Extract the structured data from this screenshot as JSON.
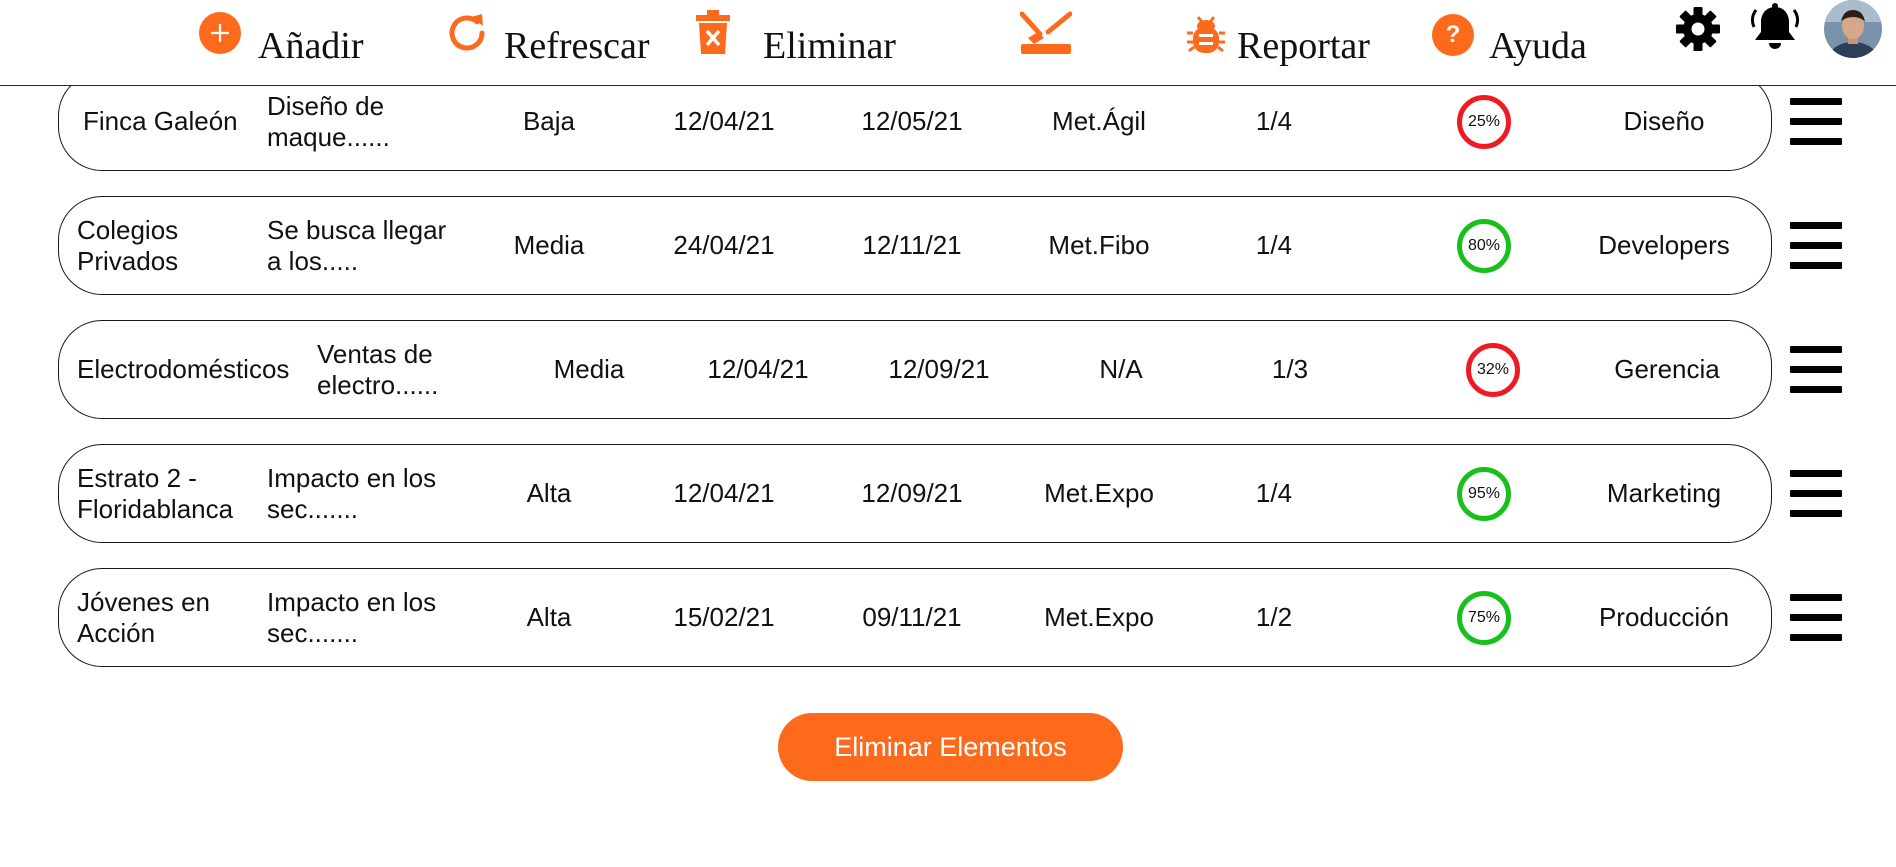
{
  "toolbar": {
    "add": "Añadir",
    "refresh": "Refrescar",
    "delete": "Eliminar",
    "report": "Reportar",
    "help": "Ayuda",
    "help_icon_glyph": "?"
  },
  "colors": {
    "accent": "#fe6a1c",
    "progress_low": "#ee1b24",
    "progress_high": "#18c01c"
  },
  "projects": [
    {
      "name": "Finca Galeón",
      "description": "Diseño de maque......",
      "priority": "Baja",
      "start": "12/04/21",
      "end": "12/05/21",
      "method": "Met.Ágil",
      "phase": "1/4",
      "progress": 25,
      "progress_label": "25%",
      "area": "Diseño"
    },
    {
      "name": "Colegios Privados",
      "description": "Se busca llegar a los.....",
      "priority": "Media",
      "start": "24/04/21",
      "end": "12/11/21",
      "method": "Met.Fibo",
      "phase": "1/4",
      "progress": 80,
      "progress_label": "80%",
      "area": "Developers"
    },
    {
      "name": "Electrodomésticos",
      "description": "Ventas de electro......",
      "priority": "Media",
      "start": "12/04/21",
      "end": "12/09/21",
      "method": "N/A",
      "phase": "1/3",
      "progress": 32,
      "progress_label": "32%",
      "area": "Gerencia"
    },
    {
      "name": "Estrato 2 - Floridablanca",
      "description": "Impacto en los sec.......",
      "priority": "Alta",
      "start": "12/04/21",
      "end": "12/09/21",
      "method": "Met.Expo",
      "phase": "1/4",
      "progress": 95,
      "progress_label": "95%",
      "area": "Marketing"
    },
    {
      "name": "Jóvenes en Acción",
      "description": "Impacto en los sec.......",
      "priority": "Alta",
      "start": "15/02/21",
      "end": "09/11/21",
      "method": "Met.Expo",
      "phase": "1/2",
      "progress": 75,
      "progress_label": "75%",
      "area": "Producción"
    }
  ],
  "delete_items_button": "Eliminar Elementos"
}
